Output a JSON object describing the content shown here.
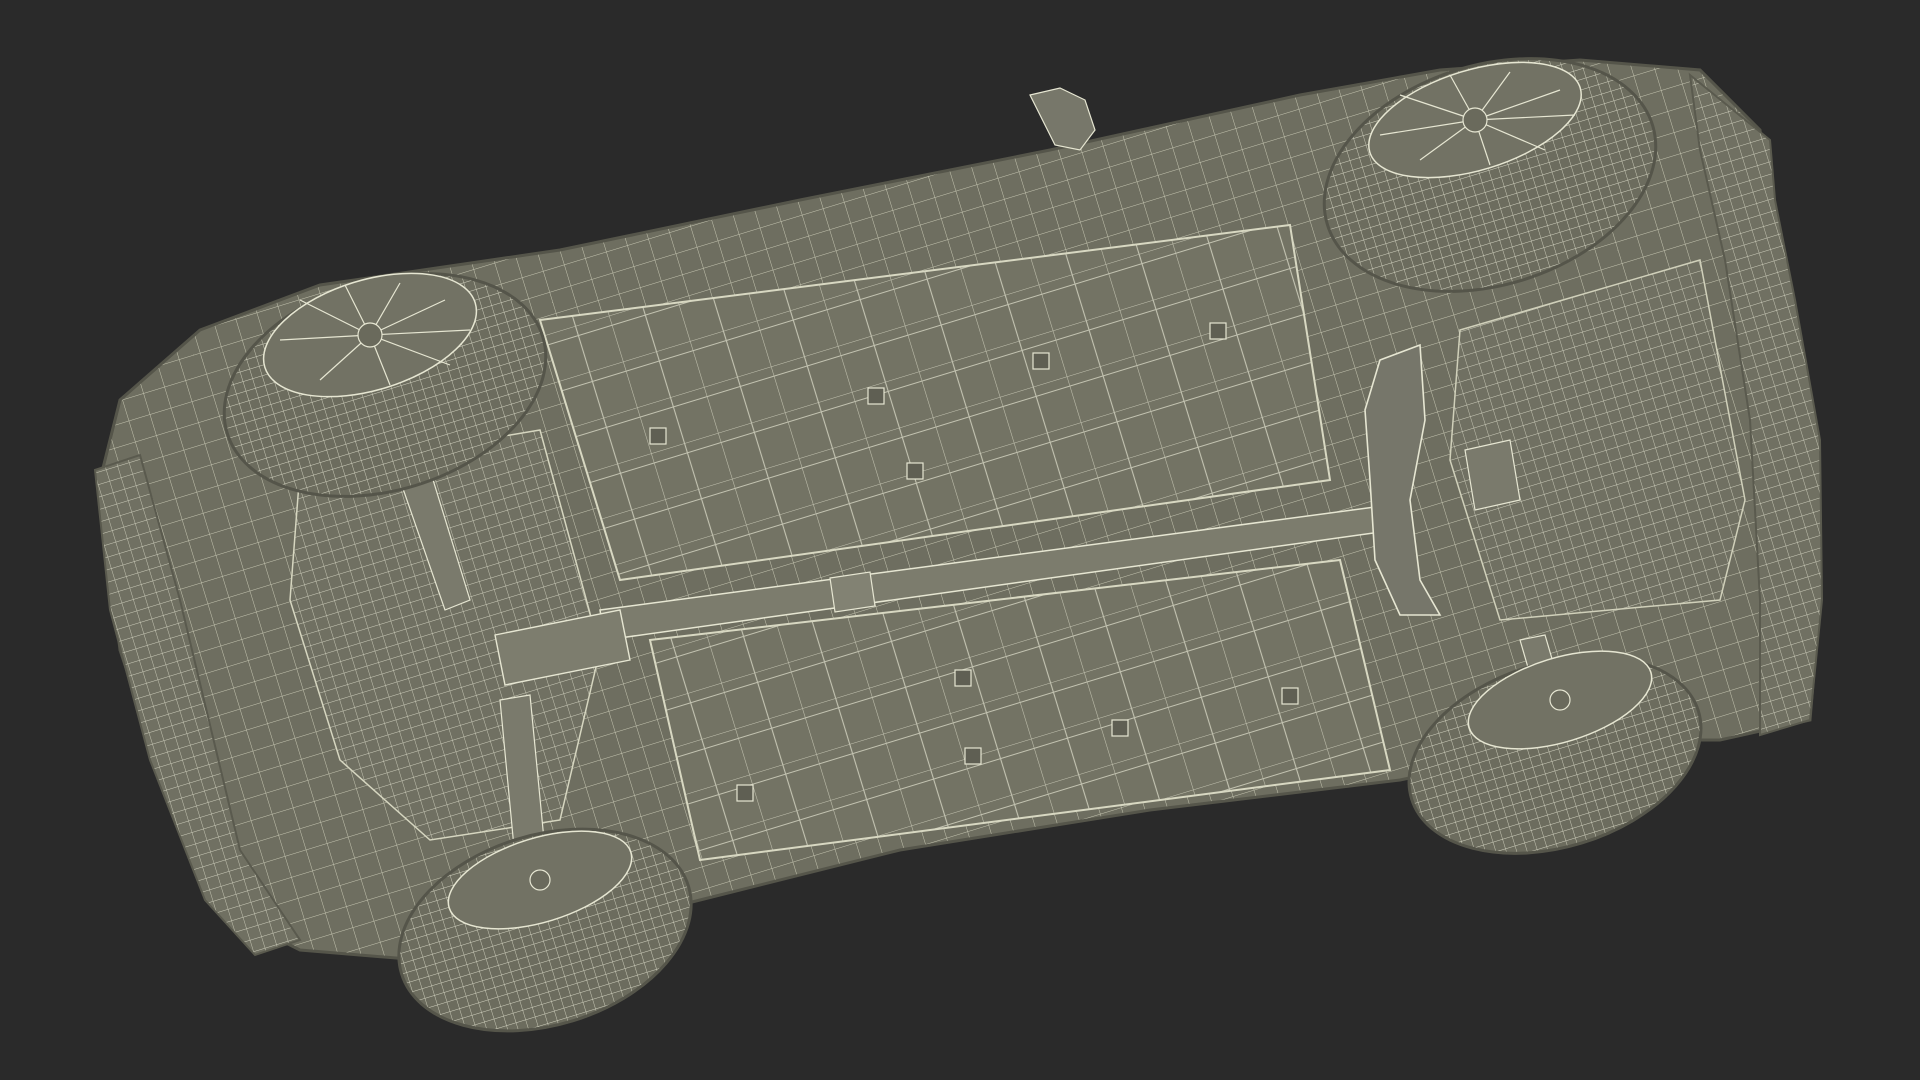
{
  "scene": {
    "subject": "wireframe-car-underside",
    "colors": {
      "background": "#2a2a2a",
      "body": "#6e6e60",
      "body_light": "#7a7a6b",
      "body_dark": "#55554a",
      "wire": "#e6e6d2",
      "tire": "#6a6a5c"
    }
  }
}
